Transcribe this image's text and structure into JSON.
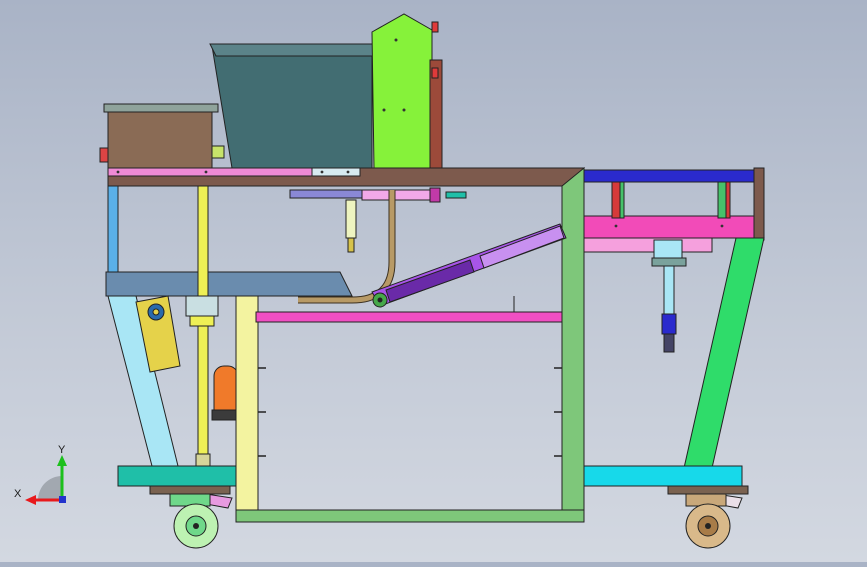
{
  "viewport": {
    "background_top": "#a9b3c6",
    "background_bottom": "#d3d8e1"
  },
  "triad": {
    "x_label": "X",
    "y_label": "Y",
    "x_color": "#e8191c",
    "y_color": "#1cc01c",
    "z_color": "#2233cc"
  },
  "colors": {
    "frame_brown": "#7d5a4d",
    "frame_green": "#7ec77a",
    "frame_yellow": "#f3f3a0",
    "light_blue": "#a9e6f5",
    "cyan": "#17d9ea",
    "pink_bar": "#f04fc3",
    "magenta_block": "#f24bb8",
    "lime_panel": "#86f23a",
    "hopper": "#426d72",
    "tan_box": "#8a6b55",
    "teal_slab": "#1fbfa8",
    "navy_rail": "#2a2acd",
    "bright_green_leg": "#2fdc6a",
    "gold": "#e5d24a",
    "yellow_rod": "#eef055",
    "purple_cyl": "#8a2ac8",
    "orange": "#f07a2a"
  }
}
